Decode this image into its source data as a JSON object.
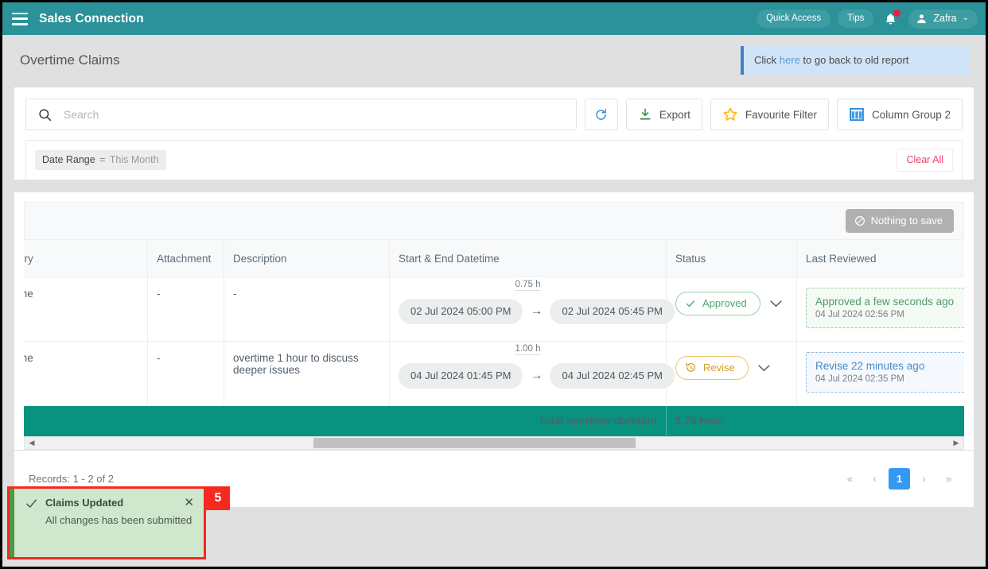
{
  "topnav": {
    "brand": "Sales Connection",
    "quick_access": "Quick Access",
    "tips": "Tips",
    "user": "Zafra",
    "caret": "⌄",
    "brand_bg": "#2a9298",
    "notification_dot_color": "#ed1c45"
  },
  "header": {
    "title": "Overtime Claims",
    "banner_prefix": "Click ",
    "banner_link": "here",
    "banner_suffix": " to go back to old report",
    "banner_accent": "#3f7fd0"
  },
  "toolbar": {
    "search_placeholder": "Search",
    "search_value": "",
    "refresh_label": "",
    "export_label": "Export",
    "favourite_filter_label": "Favourite Filter",
    "column_group_label": "Column Group 2"
  },
  "filters": {
    "chip_field": "Date Range",
    "chip_operator": "=",
    "chip_value": "This Month",
    "clear_all_label": "Clear All"
  },
  "savebar": {
    "nothing_to_save_label": "Nothing to save"
  },
  "table": {
    "columns": [
      {
        "key": "category",
        "label": "ory"
      },
      {
        "key": "attachment",
        "label": "Attachment"
      },
      {
        "key": "description",
        "label": "Description"
      },
      {
        "key": "datetime",
        "label": "Start & End Datetime"
      },
      {
        "key": "status",
        "label": "Status"
      },
      {
        "key": "reviewed",
        "label": "Last Reviewed"
      }
    ],
    "rows": [
      {
        "category": "me",
        "attachment": "-",
        "description": "-",
        "start": "02 Jul 2024 05:00 PM",
        "end": "02 Jul 2024 05:45 PM",
        "duration": "0.75 h",
        "arrow": "→",
        "status": "Approved",
        "status_type": "approved",
        "status_icon": "check-icon",
        "reviewed_title": "Approved a few seconds ago",
        "reviewed_time": "04 Jul 2024 02:56 PM",
        "reviewed_type": "green"
      },
      {
        "category": "me",
        "attachment": "-",
        "description": "overtime 1 hour to discuss deeper issues",
        "start": "04 Jul 2024 01:45 PM",
        "end": "04 Jul 2024 02:45 PM",
        "duration": "1.00 h",
        "arrow": "→",
        "status": "Revise",
        "status_type": "revise",
        "status_icon": "history-icon",
        "reviewed_title": "Revise 22 minutes ago",
        "reviewed_time": "04 Jul 2024 02:35 PM",
        "reviewed_type": "blue"
      }
    ],
    "total_label": "Total overtime duration",
    "total_value": "1.75 Hour",
    "total_bg": "#07937f"
  },
  "footer": {
    "records": "Records: 1 - 2 of 2",
    "pager": {
      "first": "«",
      "prev": "‹",
      "current": "1",
      "next": "›",
      "last": "»"
    }
  },
  "toast": {
    "title": "Claims Updated",
    "message": "All changes has been submitted",
    "close": "✕",
    "badge": "5",
    "accent": "#4a9a47",
    "badge_color": "#f5291f"
  }
}
